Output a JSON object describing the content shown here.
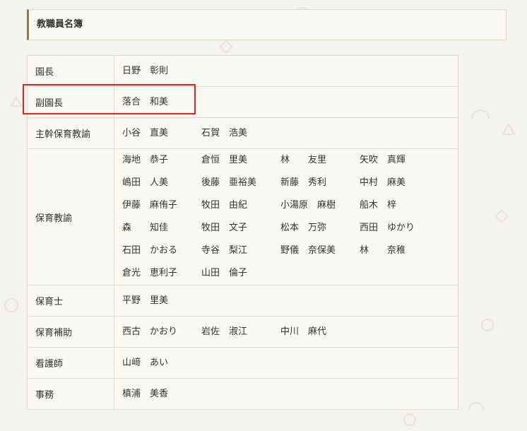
{
  "page": {
    "title": "教職員名簿"
  },
  "staff": [
    {
      "role": "園長",
      "names": [
        "日野　彰則"
      ]
    },
    {
      "role": "副園長",
      "names": [
        "落合　和美"
      ]
    },
    {
      "role": "主幹保育教諭",
      "names": [
        "小谷　直美",
        "石賀　浩美"
      ]
    },
    {
      "role": "保育教諭",
      "names": [
        "海地　恭子",
        "倉恒　里美",
        "林　　友里",
        "矢吹　真輝",
        "嶋田　人美",
        "後藤　亜裕美",
        "新藤　秀利",
        "中村　麻美",
        "伊藤　麻侑子",
        "牧田　由紀",
        "小湯原　麻樹",
        "船木　梓",
        "森　　知佳",
        "牧田　文子",
        "松本　万弥",
        "西田　ゆかり",
        "石田　かおる",
        "寺谷　梨江",
        "野儀　奈保美",
        "林　　奈稚",
        "倉光　恵利子",
        "山田　倫子"
      ]
    },
    {
      "role": "保育士",
      "names": [
        "平野　里美"
      ]
    },
    {
      "role": "保育補助",
      "names": [
        "西古　かおり",
        "岩佐　淑江",
        "中川　麻代"
      ]
    },
    {
      "role": "看護師",
      "names": [
        "山﨑　あい"
      ]
    },
    {
      "role": "事務",
      "names": [
        "槙浦　美香"
      ]
    }
  ]
}
